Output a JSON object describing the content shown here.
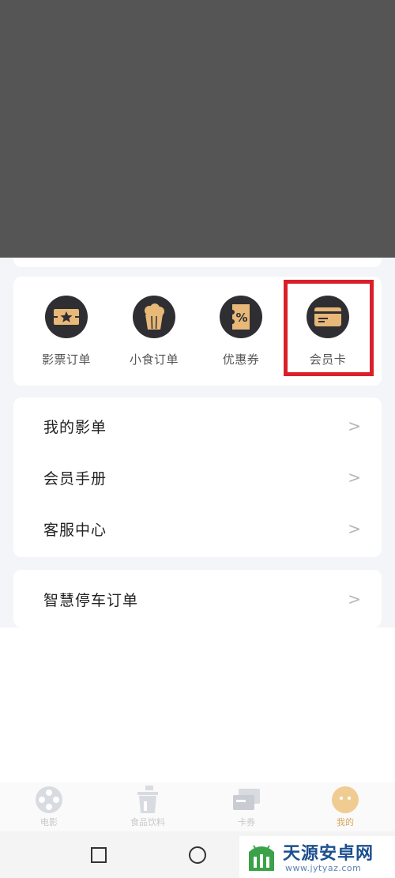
{
  "orders": {
    "items": [
      {
        "label": "影票订单",
        "icon": "ticket-icon"
      },
      {
        "label": "小食订单",
        "icon": "popcorn-icon"
      },
      {
        "label": "优惠券",
        "icon": "coupon-icon"
      },
      {
        "label": "会员卡",
        "icon": "member-card-icon"
      }
    ]
  },
  "menu_primary": {
    "items": [
      {
        "label": "我的影单"
      },
      {
        "label": "会员手册"
      },
      {
        "label": "客服中心"
      }
    ]
  },
  "menu_secondary": {
    "items": [
      {
        "label": "智慧停车订单"
      }
    ]
  },
  "chevron_glyph": ">",
  "tabbar": {
    "tabs": [
      {
        "label": "电影",
        "icon": "film-reel-icon"
      },
      {
        "label": "食品饮料",
        "icon": "drink-icon"
      },
      {
        "label": "卡券",
        "icon": "card-icon"
      },
      {
        "label": "我的",
        "icon": "profile-icon",
        "active": true
      }
    ]
  },
  "watermark": {
    "title": "天源安卓网",
    "url": "www.jytyaz.com"
  },
  "colors": {
    "overlay": "#555555",
    "accent_gold": "#d9a860",
    "icon_dark": "#2e2e33",
    "highlight_red": "#d9202a",
    "watermark_blue": "#1d4f8f"
  }
}
